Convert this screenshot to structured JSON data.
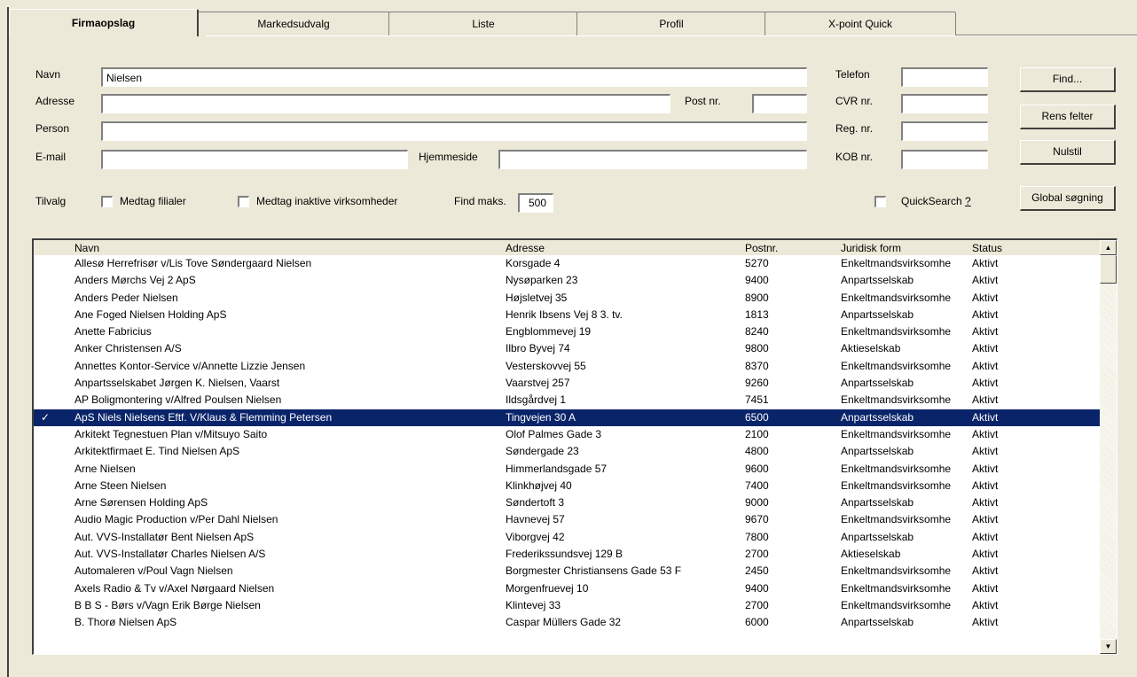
{
  "tabs": [
    "Firmaopslag",
    "Markedsudvalg",
    "Liste",
    "Profil",
    "X-point Quick"
  ],
  "form": {
    "navn_label": "Navn",
    "navn_value": "Nielsen",
    "adresse_label": "Adresse",
    "adresse_value": "",
    "postnr_label": "Post nr.",
    "postnr_value": "",
    "person_label": "Person",
    "person_value": "",
    "email_label": "E-mail",
    "email_value": "",
    "hjemmeside_label": "Hjemmeside",
    "hjemmeside_value": "",
    "telefon_label": "Telefon",
    "telefon_value": "",
    "cvr_label": "CVR nr.",
    "cvr_value": "",
    "reg_label": "Reg. nr.",
    "reg_value": "",
    "kob_label": "KOB nr.",
    "kob_value": ""
  },
  "buttons": {
    "find": "Find...",
    "rens": "Rens felter",
    "nulstil": "Nulstil",
    "global": "Global søgning"
  },
  "options": {
    "tilvalg_label": "Tilvalg",
    "filialer_label": "Medtag filialer",
    "inaktive_label": "Medtag inaktive virksomheder",
    "findmaks_label": "Find maks.",
    "findmaks_value": "500",
    "quicksearch_label": "QuickSearch",
    "quicksearch_help": "?"
  },
  "table": {
    "headers": [
      "Navn",
      "Adresse",
      "Postnr.",
      "Juridisk form",
      "Status"
    ],
    "selected_mark": "✓",
    "rows": [
      {
        "navn": "Allesø Herrefrisør v/Lis Tove Søndergaard Nielsen",
        "adresse": "Korsgade 4",
        "postnr": "5270",
        "form": "Enkeltmandsvirksomhe",
        "status": "Aktivt",
        "selected": false
      },
      {
        "navn": "Anders Mørchs Vej 2 ApS",
        "adresse": "Nysøparken 23",
        "postnr": "9400",
        "form": "Anpartsselskab",
        "status": "Aktivt",
        "selected": false
      },
      {
        "navn": "Anders Peder Nielsen",
        "adresse": "Højsletvej 35",
        "postnr": "8900",
        "form": "Enkeltmandsvirksomhe",
        "status": "Aktivt",
        "selected": false
      },
      {
        "navn": "Ane Foged Nielsen Holding ApS",
        "adresse": "Henrik Ibsens Vej 8 3. tv.",
        "postnr": "1813",
        "form": "Anpartsselskab",
        "status": "Aktivt",
        "selected": false
      },
      {
        "navn": "Anette Fabricius",
        "adresse": "Engblommevej 19",
        "postnr": "8240",
        "form": "Enkeltmandsvirksomhe",
        "status": "Aktivt",
        "selected": false
      },
      {
        "navn": "Anker Christensen A/S",
        "adresse": "Ilbro Byvej 74",
        "postnr": "9800",
        "form": "Aktieselskab",
        "status": "Aktivt",
        "selected": false
      },
      {
        "navn": "Annettes Kontor-Service v/Annette Lizzie Jensen",
        "adresse": "Vesterskovvej 55",
        "postnr": "8370",
        "form": "Enkeltmandsvirksomhe",
        "status": "Aktivt",
        "selected": false
      },
      {
        "navn": "Anpartsselskabet Jørgen K. Nielsen, Vaarst",
        "adresse": "Vaarstvej 257",
        "postnr": "9260",
        "form": "Anpartsselskab",
        "status": "Aktivt",
        "selected": false
      },
      {
        "navn": "AP Boligmontering v/Alfred Poulsen Nielsen",
        "adresse": "Ildsgårdvej 1",
        "postnr": "7451",
        "form": "Enkeltmandsvirksomhe",
        "status": "Aktivt",
        "selected": false
      },
      {
        "navn": "ApS Niels Nielsens Eftf. V/Klaus & Flemming Petersen",
        "adresse": "Tingvejen 30 A",
        "postnr": "6500",
        "form": "Anpartsselskab",
        "status": "Aktivt",
        "selected": true
      },
      {
        "navn": "Arkitekt Tegnestuen Plan v/Mitsuyo Saito",
        "adresse": "Olof Palmes Gade 3",
        "postnr": "2100",
        "form": "Enkeltmandsvirksomhe",
        "status": "Aktivt",
        "selected": false
      },
      {
        "navn": "Arkitektfirmaet E. Tind Nielsen ApS",
        "adresse": "Søndergade 23",
        "postnr": "4800",
        "form": "Anpartsselskab",
        "status": "Aktivt",
        "selected": false
      },
      {
        "navn": "Arne Nielsen",
        "adresse": "Himmerlandsgade 57",
        "postnr": "9600",
        "form": "Enkeltmandsvirksomhe",
        "status": "Aktivt",
        "selected": false
      },
      {
        "navn": "Arne Steen Nielsen",
        "adresse": "Klinkhøjvej 40",
        "postnr": "7400",
        "form": "Enkeltmandsvirksomhe",
        "status": "Aktivt",
        "selected": false
      },
      {
        "navn": "Arne Sørensen Holding ApS",
        "adresse": "Søndertoft 3",
        "postnr": "9000",
        "form": "Anpartsselskab",
        "status": "Aktivt",
        "selected": false
      },
      {
        "navn": "Audio Magic Production v/Per Dahl Nielsen",
        "adresse": "Havnevej 57",
        "postnr": "9670",
        "form": "Enkeltmandsvirksomhe",
        "status": "Aktivt",
        "selected": false
      },
      {
        "navn": "Aut. VVS-Installatør Bent Nielsen ApS",
        "adresse": "Viborgvej 42",
        "postnr": "7800",
        "form": "Anpartsselskab",
        "status": "Aktivt",
        "selected": false
      },
      {
        "navn": "Aut. VVS-Installatør Charles Nielsen A/S",
        "adresse": "Frederikssundsvej 129 B",
        "postnr": "2700",
        "form": "Aktieselskab",
        "status": "Aktivt",
        "selected": false
      },
      {
        "navn": "Automaleren v/Poul Vagn Nielsen",
        "adresse": "Borgmester Christiansens Gade 53 F",
        "postnr": "2450",
        "form": "Enkeltmandsvirksomhe",
        "status": "Aktivt",
        "selected": false
      },
      {
        "navn": "Axels Radio & Tv v/Axel Nørgaard Nielsen",
        "adresse": "Morgenfruevej 10",
        "postnr": "9400",
        "form": "Enkeltmandsvirksomhe",
        "status": "Aktivt",
        "selected": false
      },
      {
        "navn": "B B S - Børs v/Vagn Erik Børge Nielsen",
        "adresse": "Klintevej 33",
        "postnr": "2700",
        "form": "Enkeltmandsvirksomhe",
        "status": "Aktivt",
        "selected": false
      },
      {
        "navn": "B. Thorø Nielsen ApS",
        "adresse": "Caspar Müllers Gade 32",
        "postnr": "6000",
        "form": "Anpartsselskab",
        "status": "Aktivt",
        "selected": false
      }
    ]
  },
  "scrollbar": {
    "up_icon": "▲",
    "down_icon": "▼"
  }
}
